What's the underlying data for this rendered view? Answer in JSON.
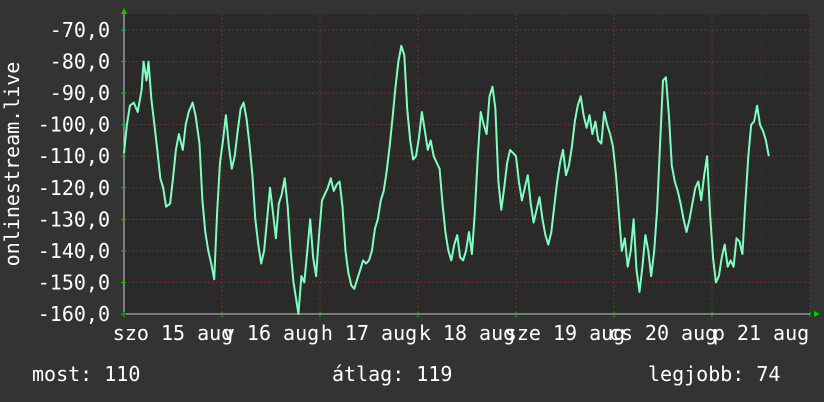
{
  "chart_data": {
    "type": "line",
    "ylabel": "onlinestream.live",
    "ylim": [
      -160,
      -70
    ],
    "y_ticks": [
      -70,
      -80,
      -90,
      -100,
      -110,
      -120,
      -130,
      -140,
      -150,
      -160
    ],
    "y_tick_labels": [
      "-70,0",
      "-80,0",
      "-90,0",
      "-100,0",
      "-110,0",
      "-120,0",
      "-130,0",
      "-140,0",
      "-150,0",
      "-160,0"
    ],
    "x_tick_labels": [
      "szo 15 aug",
      "v 16 aug",
      "h 17 aug",
      "k 18 aug",
      "sze 19 aug",
      "cs 20 aug",
      "p 21 aug"
    ],
    "x_range_days": [
      0,
      7
    ],
    "grid": true,
    "series": [
      {
        "color": "#7fffbf",
        "points": [
          [
            0.0,
            -109
          ],
          [
            0.03,
            -100
          ],
          [
            0.06,
            -94
          ],
          [
            0.1,
            -93
          ],
          [
            0.14,
            -96
          ],
          [
            0.18,
            -89
          ],
          [
            0.2,
            -80
          ],
          [
            0.23,
            -86
          ],
          [
            0.25,
            -80
          ],
          [
            0.28,
            -92
          ],
          [
            0.31,
            -100
          ],
          [
            0.34,
            -108
          ],
          [
            0.37,
            -117
          ],
          [
            0.4,
            -120
          ],
          [
            0.43,
            -126
          ],
          [
            0.47,
            -125
          ],
          [
            0.5,
            -117
          ],
          [
            0.53,
            -108
          ],
          [
            0.56,
            -103
          ],
          [
            0.6,
            -108
          ],
          [
            0.63,
            -100
          ],
          [
            0.66,
            -96
          ],
          [
            0.7,
            -93
          ],
          [
            0.73,
            -97
          ],
          [
            0.77,
            -106
          ],
          [
            0.8,
            -124
          ],
          [
            0.83,
            -134
          ],
          [
            0.86,
            -140
          ],
          [
            0.89,
            -144
          ],
          [
            0.92,
            -149
          ],
          [
            0.95,
            -128
          ],
          [
            0.98,
            -112
          ],
          [
            1.01,
            -105
          ],
          [
            1.04,
            -97
          ],
          [
            1.07,
            -107
          ],
          [
            1.1,
            -114
          ],
          [
            1.13,
            -110
          ],
          [
            1.16,
            -102
          ],
          [
            1.19,
            -95
          ],
          [
            1.22,
            -93
          ],
          [
            1.25,
            -98
          ],
          [
            1.28,
            -106
          ],
          [
            1.31,
            -116
          ],
          [
            1.34,
            -130
          ],
          [
            1.37,
            -138
          ],
          [
            1.4,
            -144
          ],
          [
            1.43,
            -140
          ],
          [
            1.46,
            -130
          ],
          [
            1.49,
            -120
          ],
          [
            1.52,
            -128
          ],
          [
            1.55,
            -136
          ],
          [
            1.58,
            -125
          ],
          [
            1.61,
            -122
          ],
          [
            1.64,
            -117
          ],
          [
            1.67,
            -126
          ],
          [
            1.7,
            -140
          ],
          [
            1.73,
            -150
          ],
          [
            1.76,
            -156
          ],
          [
            1.78,
            -160
          ],
          [
            1.81,
            -148
          ],
          [
            1.84,
            -150
          ],
          [
            1.87,
            -140
          ],
          [
            1.9,
            -130
          ],
          [
            1.93,
            -142
          ],
          [
            1.96,
            -148
          ],
          [
            1.99,
            -135
          ],
          [
            2.02,
            -124
          ],
          [
            2.05,
            -122
          ],
          [
            2.08,
            -120
          ],
          [
            2.11,
            -117
          ],
          [
            2.14,
            -121
          ],
          [
            2.17,
            -119
          ],
          [
            2.2,
            -118
          ],
          [
            2.23,
            -126
          ],
          [
            2.26,
            -140
          ],
          [
            2.29,
            -147
          ],
          [
            2.32,
            -151
          ],
          [
            2.35,
            -152
          ],
          [
            2.38,
            -149
          ],
          [
            2.41,
            -146
          ],
          [
            2.44,
            -143
          ],
          [
            2.47,
            -144
          ],
          [
            2.5,
            -143
          ],
          [
            2.53,
            -140
          ],
          [
            2.56,
            -133
          ],
          [
            2.59,
            -130
          ],
          [
            2.62,
            -124
          ],
          [
            2.65,
            -121
          ],
          [
            2.68,
            -115
          ],
          [
            2.71,
            -107
          ],
          [
            2.74,
            -98
          ],
          [
            2.77,
            -88
          ],
          [
            2.8,
            -80
          ],
          [
            2.83,
            -75
          ],
          [
            2.86,
            -78
          ],
          [
            2.89,
            -95
          ],
          [
            2.92,
            -105
          ],
          [
            2.95,
            -111
          ],
          [
            2.98,
            -110
          ],
          [
            3.01,
            -104
          ],
          [
            3.04,
            -96
          ],
          [
            3.07,
            -102
          ],
          [
            3.1,
            -108
          ],
          [
            3.13,
            -105
          ],
          [
            3.16,
            -110
          ],
          [
            3.19,
            -112
          ],
          [
            3.22,
            -114
          ],
          [
            3.25,
            -125
          ],
          [
            3.28,
            -134
          ],
          [
            3.31,
            -140
          ],
          [
            3.34,
            -143
          ],
          [
            3.37,
            -138
          ],
          [
            3.4,
            -135
          ],
          [
            3.43,
            -142
          ],
          [
            3.46,
            -143
          ],
          [
            3.49,
            -140
          ],
          [
            3.52,
            -134
          ],
          [
            3.55,
            -141
          ],
          [
            3.58,
            -128
          ],
          [
            3.61,
            -110
          ],
          [
            3.64,
            -96
          ],
          [
            3.67,
            -100
          ],
          [
            3.7,
            -103
          ],
          [
            3.73,
            -91
          ],
          [
            3.76,
            -88
          ],
          [
            3.79,
            -95
          ],
          [
            3.82,
            -118
          ],
          [
            3.85,
            -127
          ],
          [
            3.88,
            -120
          ],
          [
            3.91,
            -112
          ],
          [
            3.94,
            -108
          ],
          [
            3.97,
            -109
          ],
          [
            4.0,
            -110
          ],
          [
            4.03,
            -118
          ],
          [
            4.06,
            -124
          ],
          [
            4.09,
            -120
          ],
          [
            4.12,
            -116
          ],
          [
            4.15,
            -125
          ],
          [
            4.18,
            -131
          ],
          [
            4.21,
            -127
          ],
          [
            4.24,
            -123
          ],
          [
            4.27,
            -130
          ],
          [
            4.3,
            -135
          ],
          [
            4.33,
            -138
          ],
          [
            4.36,
            -134
          ],
          [
            4.39,
            -126
          ],
          [
            4.42,
            -118
          ],
          [
            4.45,
            -112
          ],
          [
            4.48,
            -108
          ],
          [
            4.51,
            -116
          ],
          [
            4.54,
            -113
          ],
          [
            4.57,
            -107
          ],
          [
            4.6,
            -99
          ],
          [
            4.63,
            -94
          ],
          [
            4.66,
            -91
          ],
          [
            4.69,
            -97
          ],
          [
            4.72,
            -101
          ],
          [
            4.75,
            -97
          ],
          [
            4.78,
            -103
          ],
          [
            4.81,
            -99
          ],
          [
            4.84,
            -105
          ],
          [
            4.87,
            -106
          ],
          [
            4.9,
            -96
          ],
          [
            4.93,
            -100
          ],
          [
            4.96,
            -103
          ],
          [
            4.99,
            -107
          ],
          [
            5.02,
            -116
          ],
          [
            5.05,
            -128
          ],
          [
            5.08,
            -140
          ],
          [
            5.11,
            -136
          ],
          [
            5.14,
            -145
          ],
          [
            5.17,
            -140
          ],
          [
            5.2,
            -130
          ],
          [
            5.23,
            -146
          ],
          [
            5.26,
            -153
          ],
          [
            5.29,
            -145
          ],
          [
            5.32,
            -135
          ],
          [
            5.35,
            -140
          ],
          [
            5.38,
            -148
          ],
          [
            5.41,
            -140
          ],
          [
            5.44,
            -127
          ],
          [
            5.47,
            -106
          ],
          [
            5.5,
            -86
          ],
          [
            5.53,
            -85
          ],
          [
            5.56,
            -97
          ],
          [
            5.59,
            -113
          ],
          [
            5.62,
            -118
          ],
          [
            5.65,
            -121
          ],
          [
            5.68,
            -125
          ],
          [
            5.71,
            -130
          ],
          [
            5.74,
            -134
          ],
          [
            5.77,
            -130
          ],
          [
            5.8,
            -125
          ],
          [
            5.83,
            -120
          ],
          [
            5.86,
            -118
          ],
          [
            5.89,
            -124
          ],
          [
            5.92,
            -116
          ],
          [
            5.95,
            -110
          ],
          [
            5.98,
            -128
          ],
          [
            6.01,
            -142
          ],
          [
            6.04,
            -150
          ],
          [
            6.07,
            -148
          ],
          [
            6.1,
            -142
          ],
          [
            6.13,
            -138
          ],
          [
            6.16,
            -145
          ],
          [
            6.19,
            -143
          ],
          [
            6.22,
            -145
          ],
          [
            6.25,
            -136
          ],
          [
            6.28,
            -137
          ],
          [
            6.31,
            -141
          ],
          [
            6.34,
            -125
          ],
          [
            6.37,
            -110
          ],
          [
            6.4,
            -100
          ],
          [
            6.43,
            -99
          ],
          [
            6.46,
            -94
          ],
          [
            6.49,
            -100
          ],
          [
            6.52,
            -102
          ],
          [
            6.55,
            -105
          ],
          [
            6.58,
            -110
          ]
        ]
      }
    ]
  },
  "stats": {
    "current": "most: 110",
    "average": "átlag: 119",
    "best": "legjobb: 74"
  },
  "colors": {
    "background": "#333333",
    "plot_background": "#2a2a2a",
    "grid": "#6b3030",
    "line": "#7fffbf",
    "axis_arrow": "#00cc00",
    "text": "#ffffff"
  }
}
